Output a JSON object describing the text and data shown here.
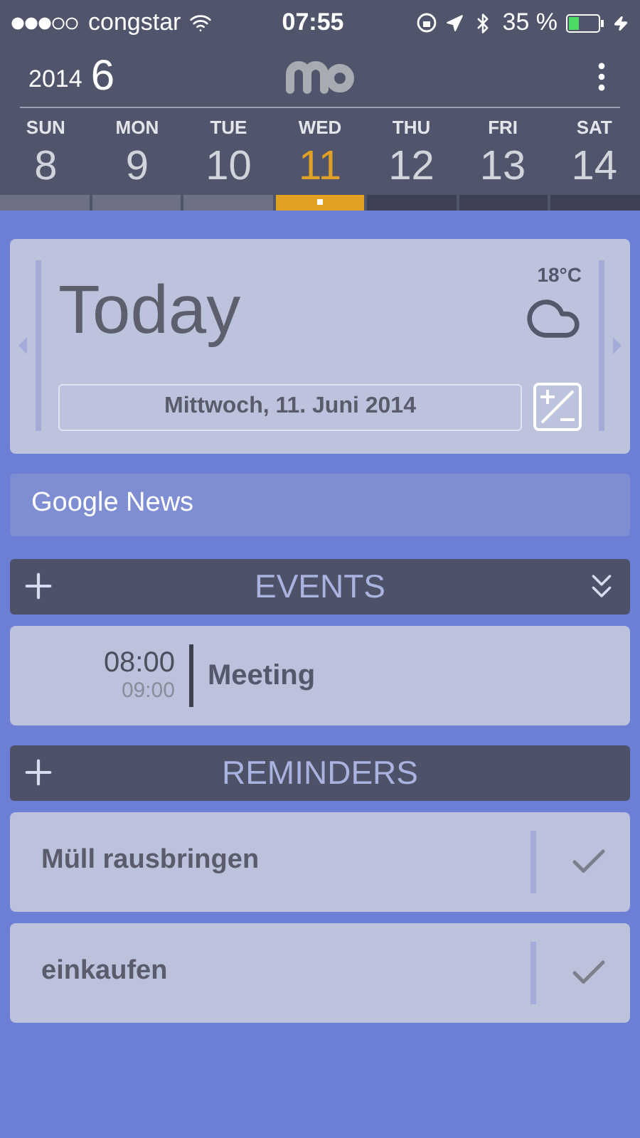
{
  "status_bar": {
    "carrier": "congstar",
    "time": "07:55",
    "battery": "35 %"
  },
  "header": {
    "year": "2014",
    "month": "6"
  },
  "days": [
    {
      "name": "SUN",
      "number": "8",
      "selected": false
    },
    {
      "name": "MON",
      "number": "9",
      "selected": false
    },
    {
      "name": "TUE",
      "number": "10",
      "selected": false
    },
    {
      "name": "WED",
      "number": "11",
      "selected": true
    },
    {
      "name": "THU",
      "number": "12",
      "selected": false
    },
    {
      "name": "FRI",
      "number": "13",
      "selected": false
    },
    {
      "name": "SAT",
      "number": "14",
      "selected": false
    }
  ],
  "today": {
    "title": "Today",
    "temperature": "18°C",
    "date": "Mittwoch, 11. Juni 2014"
  },
  "news": {
    "label": "Google News"
  },
  "events": {
    "title": "EVENTS",
    "items": [
      {
        "start": "08:00",
        "end": "09:00",
        "title": "Meeting"
      }
    ]
  },
  "reminders": {
    "title": "REMINDERS",
    "items": [
      {
        "title": "Müll rausbringen"
      },
      {
        "title": "einkaufen"
      }
    ]
  }
}
